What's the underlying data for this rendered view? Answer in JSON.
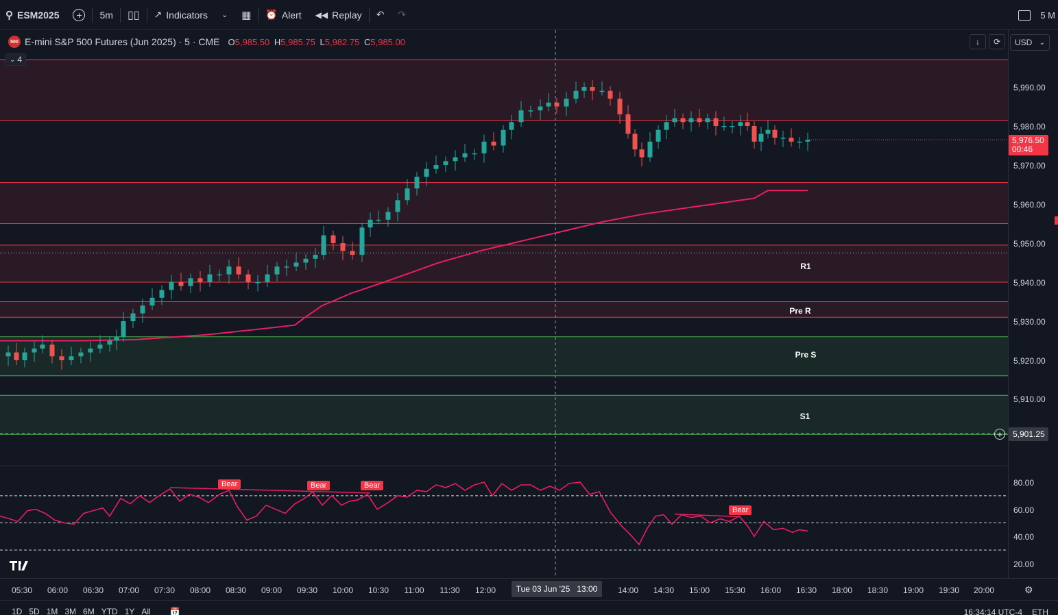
{
  "toolbar": {
    "symbol": "ESM2025",
    "interval": "5m",
    "indicators_label": "Indicators",
    "alert_label": "Alert",
    "replay_label": "Replay",
    "right_text": "5 M"
  },
  "legend": {
    "title": "E-mini S&P 500 Futures (Jun 2025) · 5 · CME",
    "open_key": "O",
    "open": "5,985.50",
    "high_key": "H",
    "high": "5,985.75",
    "low_key": "L",
    "low": "5,982.75",
    "close_key": "C",
    "close": "5,985.00",
    "collapse_count": "4",
    "logo_text": "500"
  },
  "currency": "USD",
  "price_axis": {
    "labels": [
      "5,990.00",
      "5,980.00",
      "5,970.00",
      "5,960.00",
      "5,950.00",
      "5,940.00",
      "5,930.00",
      "5,920.00",
      "5,910.00"
    ],
    "last_price": "5,976.50",
    "countdown": "00:46",
    "crosshair_price": "5,901.25"
  },
  "rsi_axis": {
    "labels": [
      "80.00",
      "60.00",
      "40.00",
      "20.00"
    ]
  },
  "zones": {
    "r1": "R1",
    "pre_r": "Pre R",
    "pre_s": "Pre S",
    "s1": "S1"
  },
  "bear_labels": [
    "Bear",
    "Bear",
    "Bear",
    "Bear"
  ],
  "time_axis": {
    "labels": [
      "05:30",
      "06:00",
      "06:30",
      "07:00",
      "07:30",
      "08:00",
      "08:30",
      "09:00",
      "09:30",
      "10:00",
      "10:30",
      "11:00",
      "11:30",
      "12:00",
      "14:00",
      "14:30",
      "15:00",
      "15:30",
      "16:00",
      "16:30",
      "18:00",
      "18:30",
      "19:00",
      "19:30",
      "20:00"
    ],
    "crosshair_date": "Tue 03 Jun '25",
    "crosshair_time": "13:00"
  },
  "bottom_bar": {
    "ranges": [
      "1D",
      "5D",
      "1M",
      "3M",
      "6M",
      "YTD",
      "1Y",
      "All"
    ],
    "clock": "16:34:14 UTC-4",
    "session": "ETH"
  },
  "colors": {
    "background": "#131722",
    "bull": "#26a69a",
    "bear": "#ef5350",
    "ma_line": "#e91e63",
    "rsi_line": "#e91e63",
    "resistance_line": "#f23645",
    "support_line": "#4caf50"
  },
  "chart_data": {
    "type": "candlestick",
    "symbol": "ESM2025",
    "timeframe": "5",
    "y_range": [
      5898,
      5995
    ],
    "rsi_range": [
      10,
      90
    ],
    "rsi_levels": [
      70,
      50,
      30
    ],
    "resistance_bands": [
      [
        5981.5,
        5997
      ],
      [
        5955,
        5965.5
      ],
      [
        5940,
        5949.5
      ],
      [
        5931,
        5935
      ]
    ],
    "support_bands": [
      [
        5916,
        5926
      ],
      [
        5901,
        5911
      ]
    ],
    "close_path": [
      [
        0,
        5921
      ],
      [
        12,
        5922
      ],
      [
        24,
        5920
      ],
      [
        36,
        5922
      ],
      [
        50,
        5923
      ],
      [
        62,
        5924
      ],
      [
        76,
        5921
      ],
      [
        90,
        5920
      ],
      [
        104,
        5921
      ],
      [
        118,
        5922
      ],
      [
        132,
        5923
      ],
      [
        146,
        5924
      ],
      [
        160,
        5925
      ],
      [
        170,
        5926
      ],
      [
        180,
        5930
      ],
      [
        194,
        5932
      ],
      [
        208,
        5934
      ],
      [
        222,
        5936
      ],
      [
        236,
        5938
      ],
      [
        250,
        5940
      ],
      [
        264,
        5939
      ],
      [
        278,
        5941
      ],
      [
        292,
        5940
      ],
      [
        306,
        5942
      ],
      [
        320,
        5942
      ],
      [
        334,
        5944
      ],
      [
        348,
        5942
      ],
      [
        362,
        5940
      ],
      [
        376,
        5940
      ],
      [
        390,
        5942
      ],
      [
        404,
        5944
      ],
      [
        418,
        5944
      ],
      [
        432,
        5945
      ],
      [
        446,
        5946
      ],
      [
        460,
        5947
      ],
      [
        472,
        5952
      ],
      [
        486,
        5950
      ],
      [
        500,
        5948
      ],
      [
        514,
        5947
      ],
      [
        528,
        5954
      ],
      [
        540,
        5956
      ],
      [
        552,
        5956
      ],
      [
        566,
        5958
      ],
      [
        580,
        5961
      ],
      [
        594,
        5964
      ],
      [
        608,
        5967
      ],
      [
        622,
        5969
      ],
      [
        636,
        5970
      ],
      [
        650,
        5971
      ],
      [
        664,
        5972
      ],
      [
        678,
        5973
      ],
      [
        692,
        5973
      ],
      [
        706,
        5976
      ],
      [
        720,
        5975
      ],
      [
        734,
        5979
      ],
      [
        746,
        5981
      ],
      [
        760,
        5984
      ],
      [
        774,
        5984
      ],
      [
        788,
        5985
      ],
      [
        800,
        5986
      ],
      [
        812,
        5985
      ],
      [
        826,
        5987
      ],
      [
        840,
        5989
      ],
      [
        852,
        5990
      ],
      [
        864,
        5989
      ],
      [
        878,
        5989
      ],
      [
        890,
        5987
      ],
      [
        904,
        5983
      ],
      [
        916,
        5978
      ],
      [
        926,
        5974
      ],
      [
        936,
        5972
      ],
      [
        948,
        5976
      ],
      [
        960,
        5979
      ],
      [
        972,
        5981
      ],
      [
        984,
        5982
      ],
      [
        996,
        5981
      ],
      [
        1008,
        5982
      ],
      [
        1020,
        5981
      ],
      [
        1032,
        5982
      ],
      [
        1044,
        5980
      ],
      [
        1056,
        5980
      ],
      [
        1068,
        5980
      ],
      [
        1080,
        5981
      ],
      [
        1090,
        5980
      ],
      [
        1100,
        5976
      ],
      [
        1110,
        5978
      ],
      [
        1120,
        5979
      ],
      [
        1130,
        5977
      ],
      [
        1142,
        5977
      ],
      [
        1154,
        5976
      ],
      [
        1166,
        5976
      ],
      [
        1178,
        5976.5
      ]
    ],
    "ma_path": [
      [
        0,
        5925
      ],
      [
        120,
        5925
      ],
      [
        200,
        5925.3
      ],
      [
        300,
        5926.5
      ],
      [
        380,
        5928
      ],
      [
        430,
        5929
      ],
      [
        445,
        5931
      ],
      [
        470,
        5934
      ],
      [
        510,
        5937
      ],
      [
        560,
        5940
      ],
      [
        600,
        5942.5
      ],
      [
        640,
        5945
      ],
      [
        700,
        5948
      ],
      [
        760,
        5950.5
      ],
      [
        820,
        5953
      ],
      [
        880,
        5955.5
      ],
      [
        940,
        5957.5
      ],
      [
        1000,
        5959
      ],
      [
        1060,
        5960.5
      ],
      [
        1100,
        5961.5
      ],
      [
        1120,
        5963.5
      ],
      [
        1178,
        5963.5
      ]
    ],
    "rsi_path": [
      [
        0,
        55
      ],
      [
        14,
        53
      ],
      [
        26,
        51
      ],
      [
        40,
        59
      ],
      [
        52,
        60
      ],
      [
        66,
        57
      ],
      [
        80,
        52
      ],
      [
        94,
        50
      ],
      [
        108,
        49
      ],
      [
        122,
        57
      ],
      [
        136,
        59
      ],
      [
        150,
        61
      ],
      [
        160,
        55
      ],
      [
        176,
        68
      ],
      [
        190,
        64
      ],
      [
        204,
        70
      ],
      [
        218,
        65
      ],
      [
        232,
        70
      ],
      [
        248,
        75
      ],
      [
        262,
        66
      ],
      [
        276,
        71
      ],
      [
        290,
        69
      ],
      [
        304,
        65
      ],
      [
        320,
        71
      ],
      [
        334,
        74
      ],
      [
        346,
        62
      ],
      [
        360,
        52
      ],
      [
        374,
        55
      ],
      [
        388,
        63
      ],
      [
        402,
        60
      ],
      [
        416,
        57
      ],
      [
        430,
        64
      ],
      [
        444,
        68
      ],
      [
        456,
        73
      ],
      [
        470,
        63
      ],
      [
        484,
        70
      ],
      [
        498,
        63
      ],
      [
        510,
        66
      ],
      [
        522,
        67
      ],
      [
        536,
        71
      ],
      [
        550,
        60
      ],
      [
        566,
        65
      ],
      [
        580,
        70
      ],
      [
        594,
        69
      ],
      [
        608,
        74
      ],
      [
        622,
        73
      ],
      [
        636,
        78
      ],
      [
        650,
        76
      ],
      [
        664,
        79
      ],
      [
        678,
        74
      ],
      [
        692,
        78
      ],
      [
        706,
        80
      ],
      [
        718,
        70
      ],
      [
        732,
        79
      ],
      [
        746,
        74
      ],
      [
        760,
        78
      ],
      [
        774,
        78
      ],
      [
        788,
        74
      ],
      [
        802,
        77
      ],
      [
        816,
        74
      ],
      [
        830,
        79
      ],
      [
        846,
        80
      ],
      [
        860,
        71
      ],
      [
        874,
        73
      ],
      [
        890,
        58
      ],
      [
        906,
        48
      ],
      [
        920,
        41
      ],
      [
        932,
        34
      ],
      [
        944,
        46
      ],
      [
        956,
        55
      ],
      [
        968,
        56
      ],
      [
        980,
        49
      ],
      [
        994,
        56
      ],
      [
        1008,
        54
      ],
      [
        1022,
        55
      ],
      [
        1036,
        50
      ],
      [
        1050,
        53
      ],
      [
        1064,
        51
      ],
      [
        1078,
        55
      ],
      [
        1090,
        48
      ],
      [
        1100,
        40
      ],
      [
        1114,
        51
      ],
      [
        1128,
        45
      ],
      [
        1142,
        46
      ],
      [
        1156,
        43
      ],
      [
        1166,
        45
      ],
      [
        1178,
        44
      ]
    ]
  }
}
